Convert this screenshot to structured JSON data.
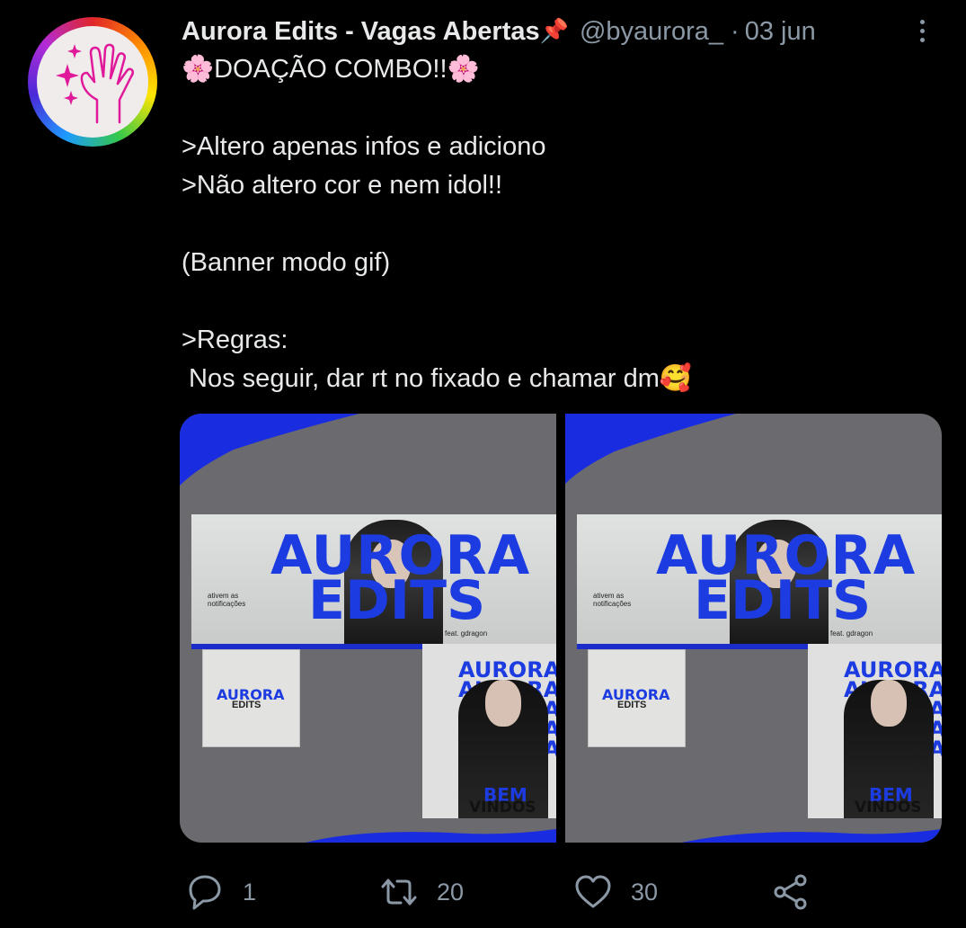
{
  "colors": {
    "background": "#000000",
    "text_primary": "#e7e9ea",
    "text_secondary": "#8b98a5",
    "brand_blue": "#1c3be0",
    "media_gray": "#6b6a6e"
  },
  "tweet": {
    "author": {
      "display_name": "Aurora Edits - Vagas Abertas",
      "pin_emoji": "📌",
      "handle": "@byaurora_",
      "separator": "·",
      "date": "03 jun"
    },
    "body_lines": [
      "🌸DOAÇÃO COMBO!!🌸",
      "",
      ">Altero apenas infos e adiciono",
      ">Não altero cor e nem idol!!",
      "",
      "(Banner modo gif)",
      "",
      ">Regras:",
      " Nos seguir, dar rt no fixado e chamar dm🥰"
    ],
    "media": [
      {
        "banner_title": "AURORA",
        "banner_subtitle": "EDITS",
        "banner_note": "ativem as notificações",
        "banner_feat": "feat. gdragon",
        "icon_title": "AURORA",
        "icon_subtitle": "EDITS",
        "post_words": "AURORA\nAURORA\nAURORA\nAURORA\nAURORA",
        "post_bem": "BEM",
        "post_vindos": "VINDOS"
      },
      {
        "banner_title": "AURORA",
        "banner_subtitle": "EDITS",
        "banner_note": "ativem as notificações",
        "banner_feat": "feat. gdragon",
        "icon_title": "AURORA",
        "icon_subtitle": "EDITS",
        "post_words": "AURORA\nAURORA\nAURORA\nAURORA\nAURORA",
        "post_bem": "BEM",
        "post_vindos": "VINDOS"
      }
    ],
    "actions": {
      "reply": {
        "icon": "reply-icon",
        "count": "1"
      },
      "retweet": {
        "icon": "retweet-icon",
        "count": "20"
      },
      "like": {
        "icon": "heart-icon",
        "count": "30"
      },
      "share": {
        "icon": "share-icon"
      }
    }
  }
}
